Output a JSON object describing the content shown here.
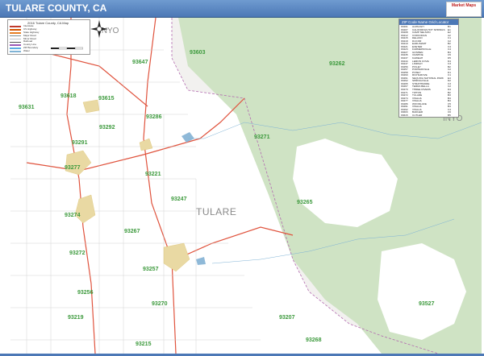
{
  "title": "TULARE COUNTY, CA",
  "brand_text": "Market Maps",
  "county_label": "TULARE",
  "neighbors": [
    "INYO",
    "INYO"
  ],
  "legend": {
    "title": "2016 Tulare County, CA Map",
    "rows": [
      {
        "label": "Interstate",
        "color": "#c0392b"
      },
      {
        "label": "US Highway",
        "color": "#d35400"
      },
      {
        "label": "State Highway",
        "color": "#e67e22"
      },
      {
        "label": "Major Road",
        "color": "#7f8c8d"
      },
      {
        "label": "Minor Road",
        "color": "#bdc3c7"
      },
      {
        "label": "Railroad",
        "color": "#555555"
      },
      {
        "label": "County Line",
        "color": "#9b59b6"
      },
      {
        "label": "ZIP Boundary",
        "color": "#5dade2"
      },
      {
        "label": "Water",
        "color": "#7fb3d5"
      }
    ]
  },
  "zip_index": {
    "title": "ZIP Code Name Grid Locator",
    "rows": [
      {
        "code": "93201",
        "name": "ALPAUGH",
        "grid": "B1"
      },
      {
        "code": "93207",
        "name": "CALIFORNIA HOT SPRINGS",
        "grid": "E1"
      },
      {
        "code": "93208",
        "name": "CAMP NELSON",
        "grid": "E2"
      },
      {
        "code": "93212",
        "name": "CORCORAN",
        "grid": "A2"
      },
      {
        "code": "93215",
        "name": "DELANO",
        "grid": "C1"
      },
      {
        "code": "93218",
        "name": "DUCOR",
        "grid": "C2"
      },
      {
        "code": "93219",
        "name": "EARLIMART",
        "grid": "B2"
      },
      {
        "code": "93221",
        "name": "EXETER",
        "grid": "C4"
      },
      {
        "code": "93223",
        "name": "FARMERSVILLE",
        "grid": "C4"
      },
      {
        "code": "93227",
        "name": "GOSHEN",
        "grid": "B4"
      },
      {
        "code": "93235",
        "name": "IVANHOE",
        "grid": "C5"
      },
      {
        "code": "93237",
        "name": "KAWEAH",
        "grid": "D5"
      },
      {
        "code": "93244",
        "name": "LEMON COVE",
        "grid": "D4"
      },
      {
        "code": "93247",
        "name": "LINDSAY",
        "grid": "C3"
      },
      {
        "code": "93256",
        "name": "PIXLEY",
        "grid": "B2"
      },
      {
        "code": "93257",
        "name": "PORTERVILLE",
        "grid": "C2"
      },
      {
        "code": "93258",
        "name": "POSEY",
        "grid": "D1"
      },
      {
        "code": "93260",
        "name": "RICHGROVE",
        "grid": "C1"
      },
      {
        "code": "93261",
        "name": "SEQUOIA NATIONAL PARK",
        "grid": "E4"
      },
      {
        "code": "93262",
        "name": "SPRINGVILLE",
        "grid": "D2"
      },
      {
        "code": "93265",
        "name": "STRATHMORE",
        "grid": "C3"
      },
      {
        "code": "93267",
        "name": "TERRA BELLA",
        "grid": "C2"
      },
      {
        "code": "93270",
        "name": "THREE RIVERS",
        "grid": "D4"
      },
      {
        "code": "93271",
        "name": "TIPTON",
        "grid": "B2"
      },
      {
        "code": "93272",
        "name": "TULARE",
        "grid": "B3"
      },
      {
        "code": "93274",
        "name": "VISALIA",
        "grid": "B4"
      },
      {
        "code": "93277",
        "name": "VISALIA",
        "grid": "B4"
      },
      {
        "code": "93286",
        "name": "WOODLAKE",
        "grid": "C5"
      },
      {
        "code": "93291",
        "name": "VISALIA",
        "grid": "B4"
      },
      {
        "code": "93292",
        "name": "VISALIA",
        "grid": "C4"
      },
      {
        "code": "93603",
        "name": "BADGER",
        "grid": "C6"
      },
      {
        "code": "93615",
        "name": "CUTLER",
        "grid": "B5"
      },
      {
        "code": "93618",
        "name": "DINUBA",
        "grid": "B5"
      },
      {
        "code": "93647",
        "name": "OROSI",
        "grid": "B6"
      },
      {
        "code": "93666",
        "name": "SULTANA",
        "grid": "B5"
      }
    ]
  },
  "zip_labels": [
    {
      "code": "93647"
    },
    {
      "code": "93603"
    },
    {
      "code": "93262"
    },
    {
      "code": "93618"
    },
    {
      "code": "93615"
    },
    {
      "code": "93631"
    },
    {
      "code": "93286"
    },
    {
      "code": "93292"
    },
    {
      "code": "93271"
    },
    {
      "code": "93291"
    },
    {
      "code": "93277"
    },
    {
      "code": "93221"
    },
    {
      "code": "93247"
    },
    {
      "code": "93265"
    },
    {
      "code": "93274"
    },
    {
      "code": "93267"
    },
    {
      "code": "93272"
    },
    {
      "code": "93257"
    },
    {
      "code": "93256"
    },
    {
      "code": "93270"
    },
    {
      "code": "93219"
    },
    {
      "code": "93207"
    },
    {
      "code": "93268"
    },
    {
      "code": "93527"
    },
    {
      "code": "93215"
    }
  ],
  "colors": {
    "title_bar": "#4c78b6",
    "forest": "#cfe3c4",
    "valley": "#ffffff",
    "zip_text": "#3d9a3d",
    "highway": "#e0533d"
  }
}
